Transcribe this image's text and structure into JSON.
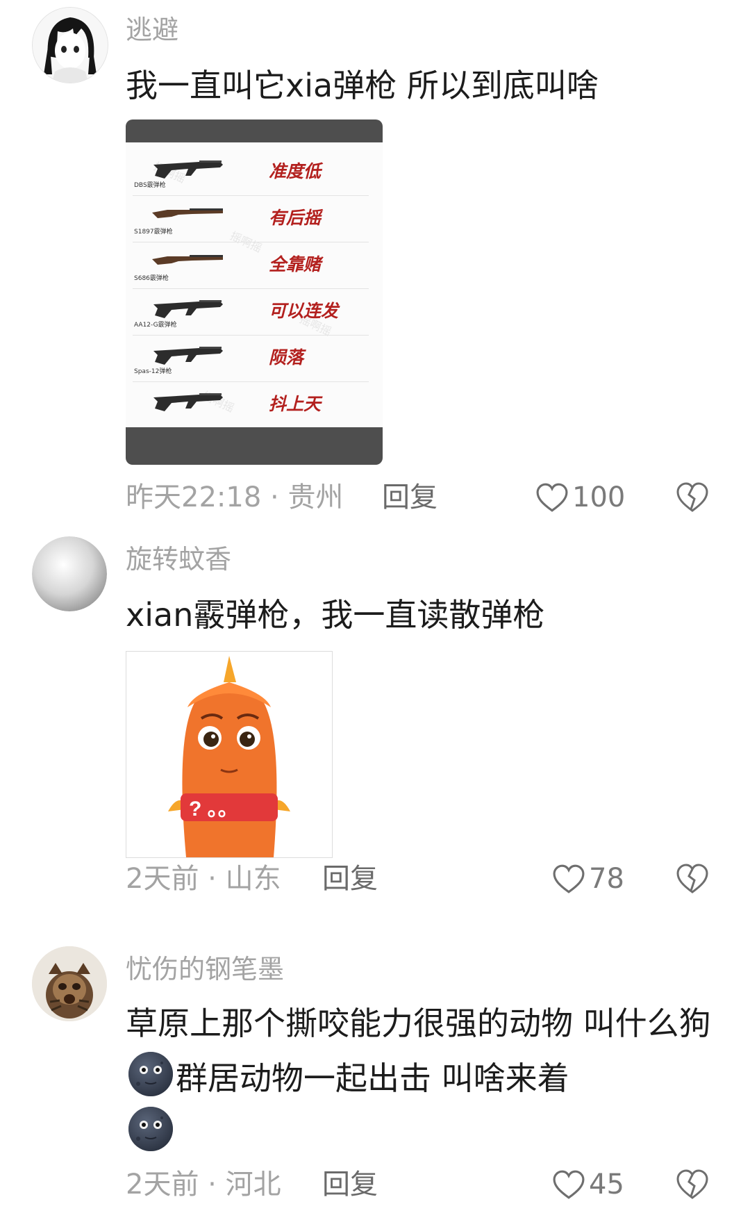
{
  "comments": [
    {
      "username": "逃避",
      "text": "我一直叫它xia弹枪  所以到底叫啥",
      "time": "昨天22:18",
      "location": "贵州",
      "reply_label": "回复",
      "likes": "100",
      "image": {
        "weapons": [
          {
            "name": "DBS霰弹枪",
            "desc": "准度低"
          },
          {
            "name": "S1897霰弹枪",
            "desc": "有后摇"
          },
          {
            "name": "S686霰弹枪",
            "desc": "全靠赌"
          },
          {
            "name": "AA12-G霰弹枪",
            "desc": "可以连发"
          },
          {
            "name": "Spas-12弹枪",
            "desc": "陨落"
          },
          {
            "name": "",
            "desc": "抖上天"
          }
        ]
      }
    },
    {
      "username": "旋转蚊香",
      "text": "xian霰弹枪，我一直读散弹枪",
      "time": "2天前",
      "location": "山东",
      "reply_label": "回复",
      "likes": "78",
      "image": {
        "sign_text": "? 。。"
      }
    },
    {
      "username": "忧伤的钢笔墨",
      "text_part1": "草原上那个撕咬能力很强的动物 叫什么狗",
      "text_part2": "群居动物一起出击 叫啥来着",
      "time": "2天前",
      "location": "河北",
      "reply_label": "回复",
      "likes": "45",
      "emoji": "moon-face-emoji"
    }
  ],
  "separator": " · ",
  "icons": [
    "heart-outline-icon",
    "broken-heart-icon"
  ],
  "colors": {
    "meta": "#a3a3a3",
    "weapon_desc": "#b3201e",
    "card_frame": "#4e4e4e"
  }
}
